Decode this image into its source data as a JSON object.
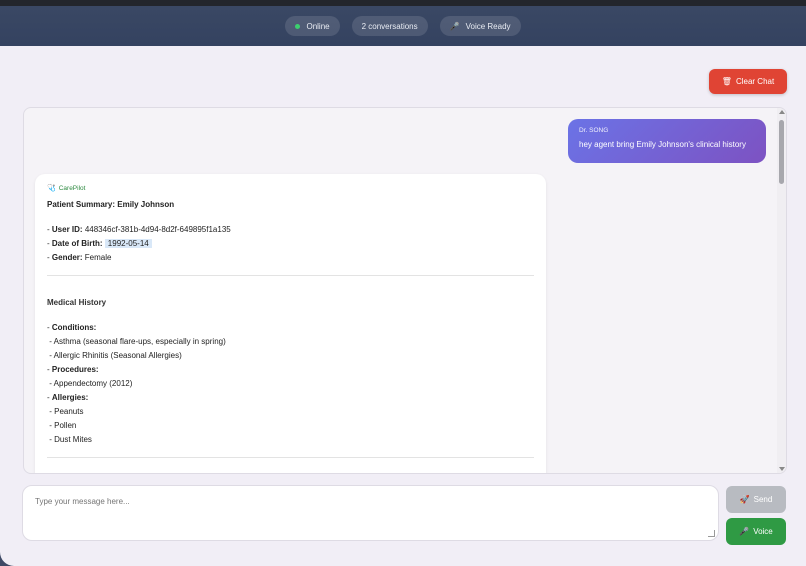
{
  "header": {
    "status": "Online",
    "conversations": "2 conversations",
    "voice": "Voice Ready"
  },
  "toolbar": {
    "clear_label": "Clear Chat"
  },
  "chat": {
    "user_message": {
      "sender": "Dr. SONG",
      "text": "hey agent bring Emily Johnson's clinical history"
    },
    "agent_message": {
      "sender": "CarePilot",
      "summary_title": "Patient Summary: Emily Johnson",
      "user_id_label": "User ID:",
      "user_id": "448346cf-381b-4d94-8d2f-649895f1a135",
      "dob_label": "Date of Birth:",
      "dob": "1992-05-14",
      "gender_label": "Gender:",
      "gender": "Female",
      "medical_history_title": "Medical History",
      "conditions_label": "Conditions:",
      "conditions": [
        "Asthma (seasonal flare-ups, especially in spring)",
        "Allergic Rhinitis (Seasonal Allergies)"
      ],
      "procedures_label": "Procedures:",
      "procedures": [
        "Appendectomy (2012)"
      ],
      "allergies_label": "Allergies:",
      "allergies": [
        "Peanuts",
        "Pollen",
        "Dust Mites"
      ]
    }
  },
  "composer": {
    "placeholder": "Type your message here...",
    "send_label": "Send",
    "voice_label": "Voice"
  },
  "colors": {
    "accent_user": "#6b73e6",
    "clear": "#e04434",
    "voice": "#2f9a44",
    "send_disabled": "#b8bbc1"
  },
  "icons": {
    "status": "online-dot-icon",
    "voice": "microphone-icon",
    "clear": "trash-icon",
    "agent": "agent-icon",
    "send": "send-icon"
  }
}
